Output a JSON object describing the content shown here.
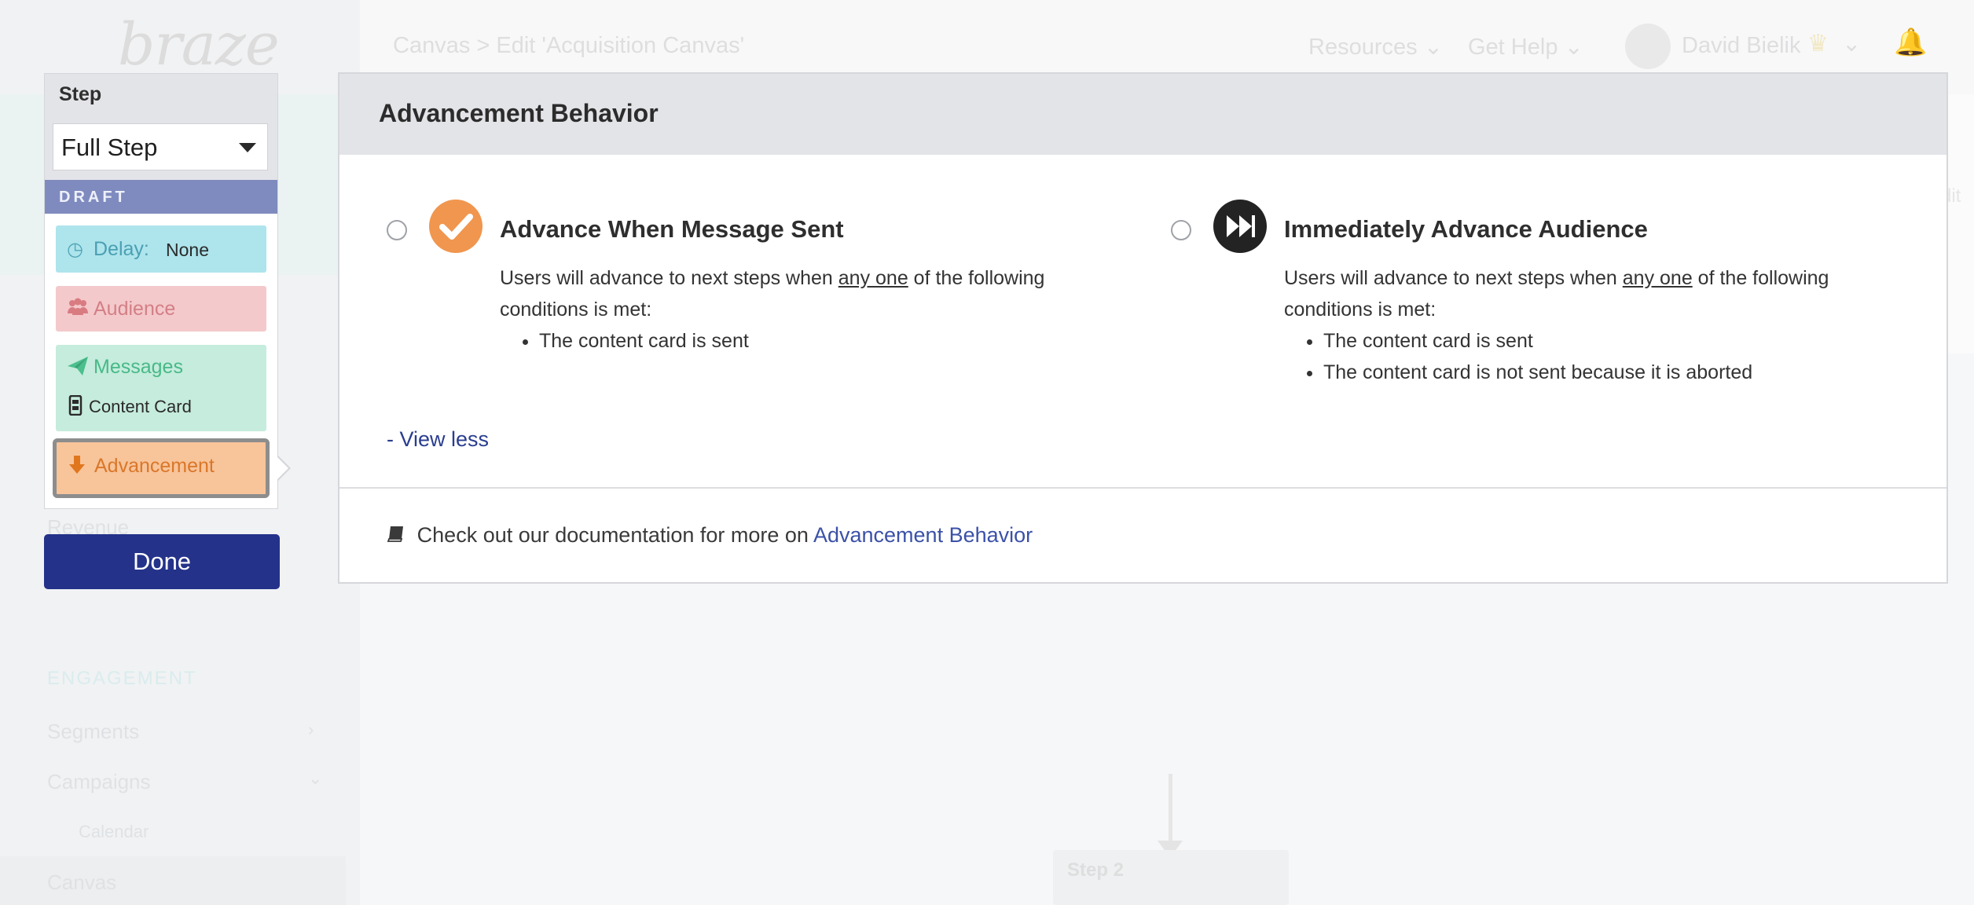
{
  "background": {
    "logo": "braze",
    "breadcrumb": "Canvas > Edit 'Acquisition Canvas'",
    "top_links": [
      "Resources",
      "Get Help"
    ],
    "user_name": "David Bielik",
    "sidebar": {
      "section": "ENGAGEMENT",
      "items": [
        "Revenue",
        "Segments",
        "Campaigns",
        "Calendar",
        "Canvas"
      ]
    },
    "canvas_step": "Step 2",
    "edit_hint": "dit"
  },
  "step_panel": {
    "label": "Step",
    "select_value": "Full Step",
    "status": "DRAFT",
    "tiles": {
      "delay_label": "Delay:",
      "delay_value": "None",
      "audience_label": "Audience",
      "messages_label": "Messages",
      "message_channel": "Content Card",
      "advancement_label": "Advancement"
    },
    "done_label": "Done"
  },
  "modal": {
    "title": "Advancement Behavior",
    "options": [
      {
        "title": "Advance When Message Sent",
        "desc_prefix": "Users will advance to next steps when ",
        "desc_emphasis": "any one",
        "desc_suffix": " of the following conditions is met:",
        "conditions": [
          "The content card is sent"
        ],
        "icon": "check-icon",
        "color": "#f0964f"
      },
      {
        "title": "Immediately Advance Audience",
        "desc_prefix": "Users will advance to next steps when ",
        "desc_emphasis": "any one",
        "desc_suffix": " of the following conditions is met:",
        "conditions": [
          "The content card is sent",
          "The content card is not sent because it is aborted"
        ],
        "icon": "fast-forward-icon",
        "color": "#232323"
      }
    ],
    "view_less": "- View less",
    "doc_text": "Check out our documentation for more on ",
    "doc_link": "Advancement Behavior"
  },
  "colors": {
    "primary": "#24328a",
    "draft": "#7f8bbf",
    "delay": "#aee4ec",
    "audience": "#f4c9cb",
    "messages": "#c5ecdd",
    "advancement": "#f8c49a"
  }
}
